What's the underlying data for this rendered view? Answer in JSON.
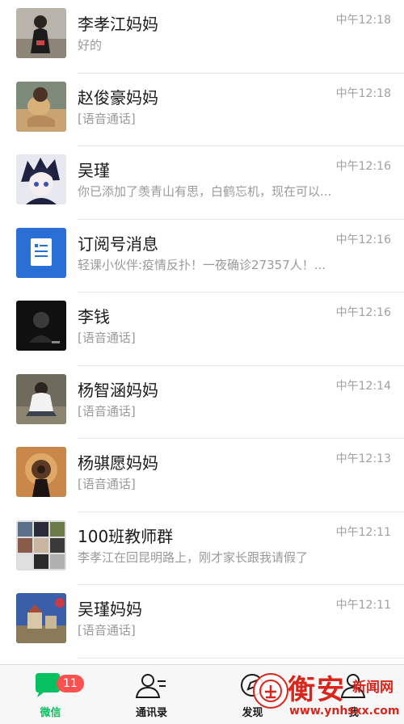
{
  "chats": [
    {
      "name": "李孝江妈妈",
      "preview": "好的",
      "time": "中午12:18",
      "avatar": "photo-girl-dark-jacket"
    },
    {
      "name": "赵俊豪妈妈",
      "preview": "[语音通话]",
      "time": "中午12:18",
      "avatar": "photo-child-sand"
    },
    {
      "name": "吴瑾",
      "preview": "你已添加了羡青山有思，白鹤忘机，现在可以...",
      "time": "中午12:16",
      "avatar": "anime-boy"
    },
    {
      "name": "订阅号消息",
      "preview": "轻课小伙伴:疫情反扑！一夜确诊27357人！...",
      "time": "中午12:16",
      "avatar": "subscription-doc-icon"
    },
    {
      "name": "李钱",
      "preview": "[语音通话]",
      "time": "中午12:16",
      "avatar": "photo-dark-figure"
    },
    {
      "name": "杨智涵妈妈",
      "preview": "[语音通话]",
      "time": "中午12:14",
      "avatar": "photo-boy-white-jacket"
    },
    {
      "name": "杨骐愿妈妈",
      "preview": "[语音通话]",
      "time": "中午12:13",
      "avatar": "photo-dandelion-sunset"
    },
    {
      "name": "100班教师群",
      "preview": "李孝江在回昆明路上，刚才家长跟我请假了",
      "time": "中午12:11",
      "avatar": "group-grid"
    },
    {
      "name": "吴瑾妈妈",
      "preview": "[语音通话]",
      "time": "中午12:11",
      "avatar": "photo-castle-sky"
    }
  ],
  "tabbar": {
    "tabs": [
      {
        "label": "微信",
        "icon": "chat-bubble-icon"
      },
      {
        "label": "通讯录",
        "icon": "contacts-icon"
      },
      {
        "label": "发现",
        "icon": "compass-icon"
      },
      {
        "label": "我",
        "icon": "person-icon"
      }
    ],
    "badge": "11",
    "active_color": "#07c160",
    "badge_color": "#fa5151"
  },
  "watermark": {
    "title": "衡安",
    "subtitle": "新闻网",
    "url": "www.ynhsxx.com",
    "color": "#d9261c"
  }
}
